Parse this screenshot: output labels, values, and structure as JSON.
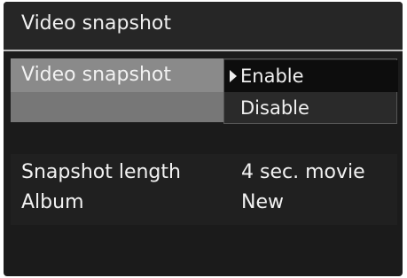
{
  "screen": {
    "title": "Video snapshot"
  },
  "settings": [
    {
      "label": "Video snapshot"
    },
    {
      "label": "Snapshot length",
      "value": "4 sec. movie"
    },
    {
      "label": "Album",
      "value": "New"
    }
  ],
  "popup": {
    "options": [
      {
        "label": "Enable",
        "selected": true
      },
      {
        "label": "Disable",
        "selected": false
      }
    ]
  },
  "colors": {
    "background": "#1b1b1b",
    "highlight": "#8a8a8a",
    "selected_option": "#0d0d0d",
    "text": "#f0f0f0"
  }
}
